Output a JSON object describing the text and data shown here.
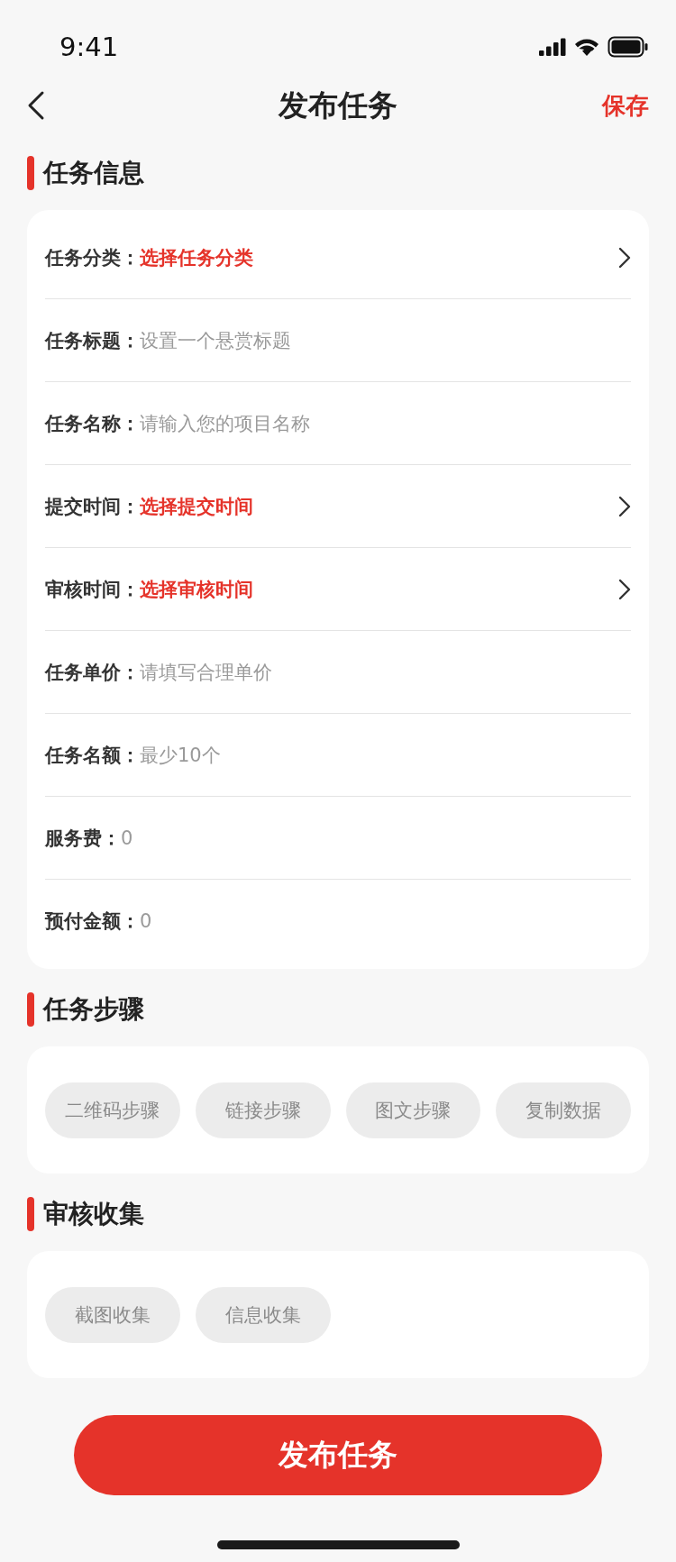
{
  "status_bar": {
    "time": "9:41"
  },
  "nav": {
    "title": "发布任务",
    "action": "保存"
  },
  "sections": [
    {
      "title": "任务信息",
      "kind": "form",
      "rows": [
        {
          "kind": "select",
          "label": "任务分类：",
          "value": "选择任务分类"
        },
        {
          "kind": "input",
          "label": "任务标题：",
          "placeholder": "设置一个悬赏标题"
        },
        {
          "kind": "input",
          "label": "任务名称：",
          "placeholder": "请输入您的项目名称"
        },
        {
          "kind": "select",
          "label": "提交时间：",
          "value": "选择提交时间"
        },
        {
          "kind": "select",
          "label": "审核时间：",
          "value": "选择审核时间"
        },
        {
          "kind": "input",
          "label": "任务单价：",
          "placeholder": "请填写合理单价"
        },
        {
          "kind": "input",
          "label": "任务名额：",
          "placeholder": "最少10个"
        },
        {
          "kind": "readonly",
          "label": "服务费：",
          "value": "0"
        },
        {
          "kind": "readonly",
          "label": "预付金额：",
          "value": "0"
        }
      ]
    },
    {
      "title": "任务步骤",
      "kind": "chips",
      "chips": [
        "二维码步骤",
        "链接步骤",
        "图文步骤",
        "复制数据"
      ]
    },
    {
      "title": "审核收集",
      "kind": "chips",
      "chips": [
        "截图收集",
        "信息收集"
      ]
    }
  ],
  "submit": "发布任务"
}
